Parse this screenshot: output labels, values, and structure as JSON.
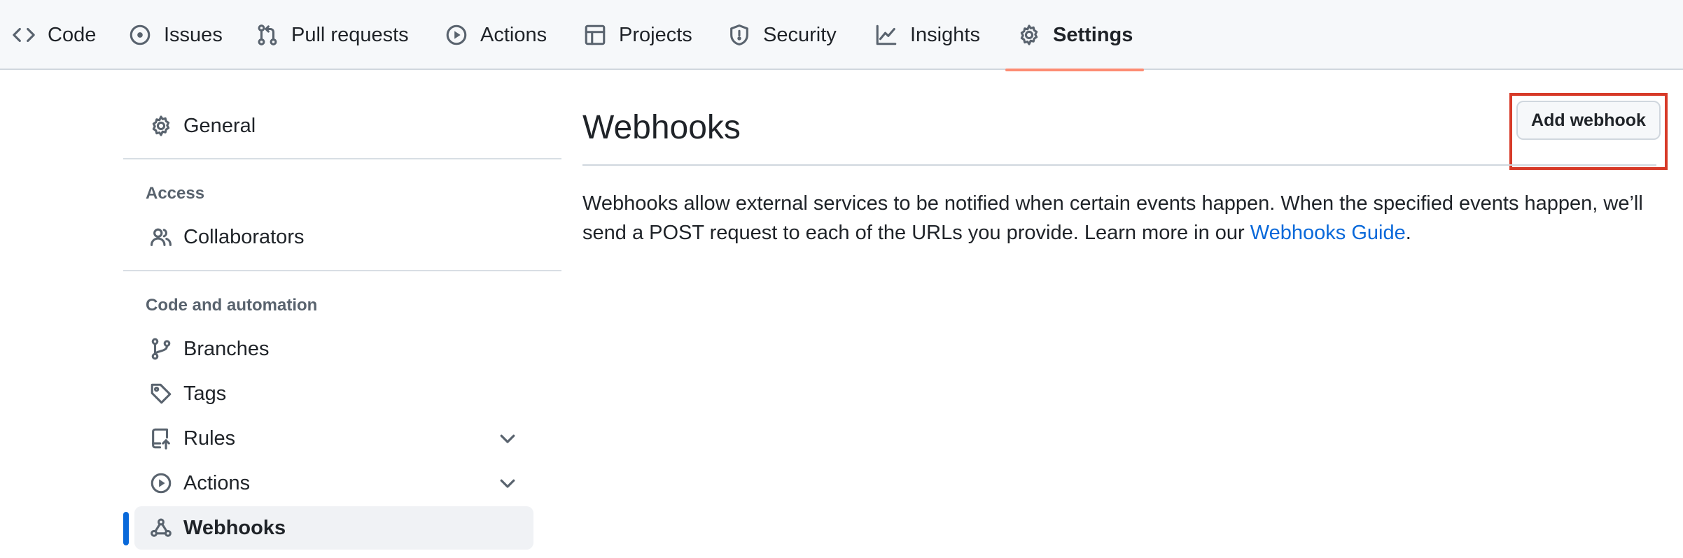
{
  "repo_nav": {
    "tabs": [
      {
        "label": "Code",
        "icon": "code-icon"
      },
      {
        "label": "Issues",
        "icon": "issue-opened-icon"
      },
      {
        "label": "Pull requests",
        "icon": "git-pull-request-icon"
      },
      {
        "label": "Actions",
        "icon": "play-icon"
      },
      {
        "label": "Projects",
        "icon": "table-icon"
      },
      {
        "label": "Security",
        "icon": "shield-icon"
      },
      {
        "label": "Insights",
        "icon": "graph-icon"
      },
      {
        "label": "Settings",
        "icon": "gear-icon",
        "selected": true
      }
    ],
    "active_underline_color": "#fd8c73"
  },
  "sidebar": {
    "general": {
      "label": "General",
      "icon": "gear-icon"
    },
    "access_heading": "Access",
    "collaborators": {
      "label": "Collaborators",
      "icon": "people-icon"
    },
    "code_automation_heading": "Code and automation",
    "branches": {
      "label": "Branches",
      "icon": "git-branch-icon"
    },
    "tags": {
      "label": "Tags",
      "icon": "tag-icon"
    },
    "rules": {
      "label": "Rules",
      "icon": "repo-push-icon",
      "expandable": true
    },
    "actions": {
      "label": "Actions",
      "icon": "play-icon",
      "expandable": true
    },
    "webhooks": {
      "label": "Webhooks",
      "icon": "webhook-icon",
      "selected": true
    },
    "active_indicator_color": "#0969da"
  },
  "main": {
    "title": "Webhooks",
    "add_button_label": "Add webhook",
    "highlight_color": "#d73a28",
    "description_text": "Webhooks allow external services to be notified when certain events happen. When the specified events happen, we’ll send a POST request to each of the URLs you provide. Learn more in our ",
    "guide_link_label": "Webhooks Guide",
    "description_end": ".",
    "link_color": "#0969da"
  }
}
